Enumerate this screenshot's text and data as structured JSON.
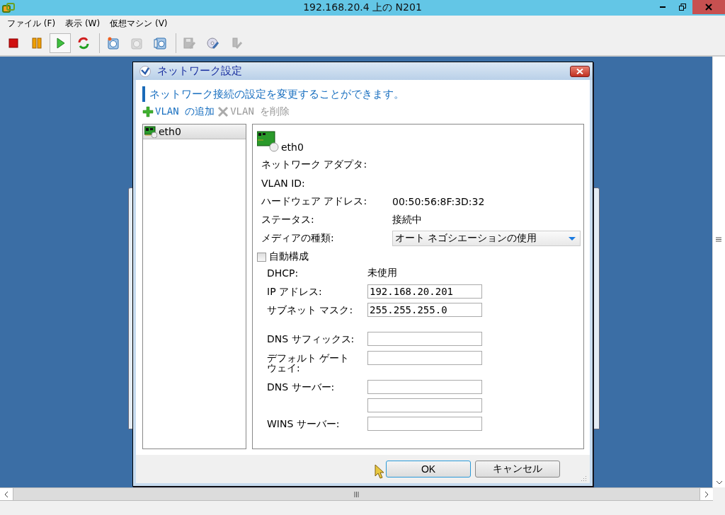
{
  "window": {
    "title": "192.168.20.4 上の N201"
  },
  "menu": [
    {
      "label": "ファイル (F)"
    },
    {
      "label": "表示 (W)"
    },
    {
      "label": "仮想マシン (V)"
    }
  ],
  "toolbar": [
    {
      "kind": "stop",
      "selected": false,
      "disabled": false
    },
    {
      "kind": "pause",
      "selected": false,
      "disabled": false
    },
    {
      "kind": "play",
      "selected": true,
      "disabled": false
    },
    {
      "kind": "reset",
      "selected": false,
      "disabled": false
    },
    {
      "kind": "sep"
    },
    {
      "kind": "snapshot",
      "selected": false,
      "disabled": false
    },
    {
      "kind": "revert",
      "selected": false,
      "disabled": true
    },
    {
      "kind": "manager",
      "selected": false,
      "disabled": false
    },
    {
      "kind": "sep"
    },
    {
      "kind": "floppy",
      "selected": false,
      "disabled": true
    },
    {
      "kind": "cd",
      "selected": false,
      "disabled": false
    },
    {
      "kind": "usb",
      "selected": false,
      "disabled": true
    }
  ],
  "dialog": {
    "title": "ネットワーク設定",
    "instruction": "ネットワーク接続の設定を変更することができます。",
    "actions": [
      {
        "kind": "add",
        "label": "VLAN の追加",
        "disabled": false
      },
      {
        "kind": "remove",
        "label": "VLAN を削除",
        "disabled": true
      }
    ],
    "adapters": [
      {
        "label": "eth0",
        "selected": true
      }
    ],
    "detail": {
      "header": "eth0",
      "info": [
        {
          "label": "ネットワーク アダプタ:"
        },
        {
          "label": "VLAN ID:"
        },
        {
          "label": "ハードウェア アドレス:",
          "value": "00:50:56:8F:3D:32"
        },
        {
          "label": "ステータス:",
          "value": "接続中"
        }
      ],
      "media_type": {
        "label": "メディアの種類:",
        "value": "オート ネゴシエーションの使用"
      },
      "auto_config": {
        "label": "自動構成",
        "checked": false
      },
      "ip_settings": [
        {
          "kind": "text",
          "label": "DHCP:",
          "value": "未使用"
        },
        {
          "kind": "field",
          "label": "IP アドレス:",
          "value": "192.168.20.201"
        },
        {
          "kind": "field",
          "label": "サブネット マスク:",
          "value": "255.255.255.0"
        },
        {
          "kind": "field",
          "label": "DNS サフィックス:"
        },
        {
          "kind": "field",
          "label": "デフォルト ゲートウェイ:"
        },
        {
          "kind": "field",
          "label": "DNS サーバー:"
        },
        {
          "kind": "field"
        },
        {
          "kind": "field",
          "label": "WINS サーバー:"
        }
      ]
    },
    "buttons": [
      {
        "label": "OK",
        "default": true
      },
      {
        "label": "キャンセル",
        "default": false
      }
    ]
  }
}
